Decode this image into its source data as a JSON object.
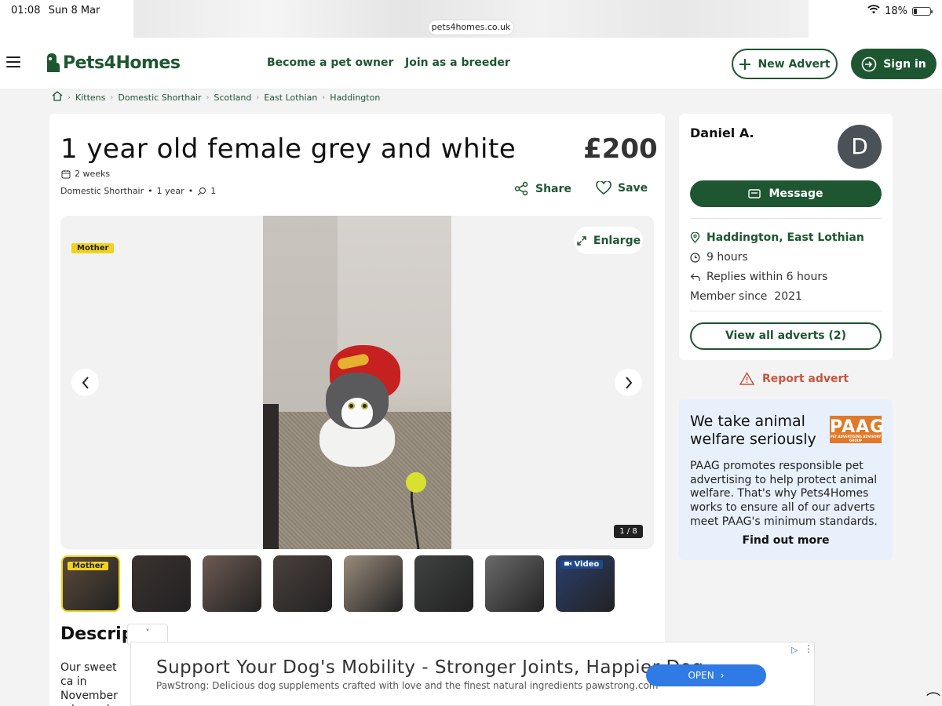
{
  "status_bar": {
    "time": "01:08",
    "date": "Sun 8 Mar",
    "battery": "18%"
  },
  "browser": {
    "url": "pets4homes.co.uk"
  },
  "header": {
    "logo": "Pets4Homes",
    "nav": [
      "Become a pet owner",
      "Join as a breeder"
    ],
    "new_advert": "New Advert",
    "sign_in": "Sign in"
  },
  "breadcrumb": [
    "Kittens",
    "Domestic Shorthair",
    "Scotland",
    "East Lothian",
    "Haddington"
  ],
  "listing": {
    "title": "1 year old female grey and white",
    "price": "£200",
    "posted": "2 weeks",
    "breed": "Domestic Shorthair",
    "age": "1 year",
    "count": "1",
    "share": "Share",
    "save": "Save"
  },
  "gallery": {
    "tag": "Mother",
    "enlarge": "Enlarge",
    "counter": "1 / 8",
    "current_index": 1,
    "total": 8,
    "thumbs": [
      {
        "tag": "Mother",
        "active": true,
        "color": "#5b4a3a"
      },
      {
        "tag": "",
        "active": false,
        "color": "#3a3230"
      },
      {
        "tag": "",
        "active": false,
        "color": "#6d5a52"
      },
      {
        "tag": "",
        "active": false,
        "color": "#4a403c"
      },
      {
        "tag": "",
        "active": false,
        "color": "#9a8c7c"
      },
      {
        "tag": "",
        "active": false,
        "color": "#3e4240"
      },
      {
        "tag": "",
        "active": false,
        "color": "#6a6a6a"
      },
      {
        "tag": "Video",
        "active": false,
        "color": "#2b3f6e"
      }
    ]
  },
  "description": {
    "heading": "Descript",
    "body": "Our sweet ca in November rehomed so s"
  },
  "seller": {
    "name": "Daniel A.",
    "initial": "D",
    "message": "Message",
    "location": "Haddington, East Lothian",
    "active": "9 hours",
    "replies": "Replies within 6 hours",
    "member_since": "Member since  2021",
    "view_all": "View all adverts (2)"
  },
  "report": "Report advert",
  "paag": {
    "title": "We take animal welfare seriously",
    "logo": "PAAG",
    "logo_sub": "PET ADVERTISING ADVISORY GROUP",
    "text": "PAAG promotes responsible pet advertising to help protect animal welfare. That's why Pets4Homes works to ensure all of our adverts meet PAAG's minimum standards.",
    "link": "Find out more"
  },
  "ad": {
    "headline": "Support Your Dog's Mobility - Stronger Joints, Happier Dog",
    "sub": "PawStrong: Delicious dog supplements crafted with love and the finest natural ingredients pawstrong.com",
    "cta": "OPEN"
  },
  "colors": {
    "brand": "#1e5631",
    "accent_yellow": "#f2d21e",
    "warning": "#c8553d",
    "ad_blue": "#2f7ae5"
  }
}
